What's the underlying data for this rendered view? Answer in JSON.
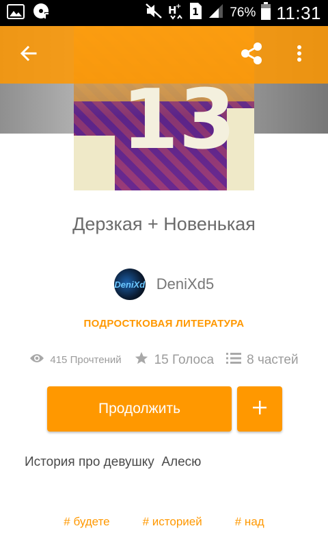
{
  "colors": {
    "accent": "#ff9800",
    "toolbar": "#ff9800",
    "status_bar": "#000000"
  },
  "status_bar": {
    "icons": [
      "image-icon",
      "music-disc-icon",
      "muted-icon",
      "hplus-signal-icon",
      "sim-1-icon",
      "signal-bars-icon"
    ],
    "sim_label": "1",
    "battery": "76%",
    "time": "11:31"
  },
  "toolbar": {
    "back_icon": "arrow-back-icon",
    "share_icon": "share-icon",
    "more_icon": "more-vert-icon"
  },
  "story": {
    "cover_number": "13",
    "title": "Дерзкая + Новенькая",
    "author": {
      "name": "DeniXd5",
      "avatar_text": "DeniXd"
    },
    "category": "ПОДРОСТКОВАЯ ЛИТЕРАТУРА",
    "stats": {
      "reads": "415 Прочтений",
      "votes": "15 Голоса",
      "parts": "8 частей"
    },
    "continue_label": "Продолжить",
    "add_label": "+",
    "description": "История про девушку  Алесю",
    "tags": [
      "# будете",
      "# историей",
      "# над"
    ]
  }
}
